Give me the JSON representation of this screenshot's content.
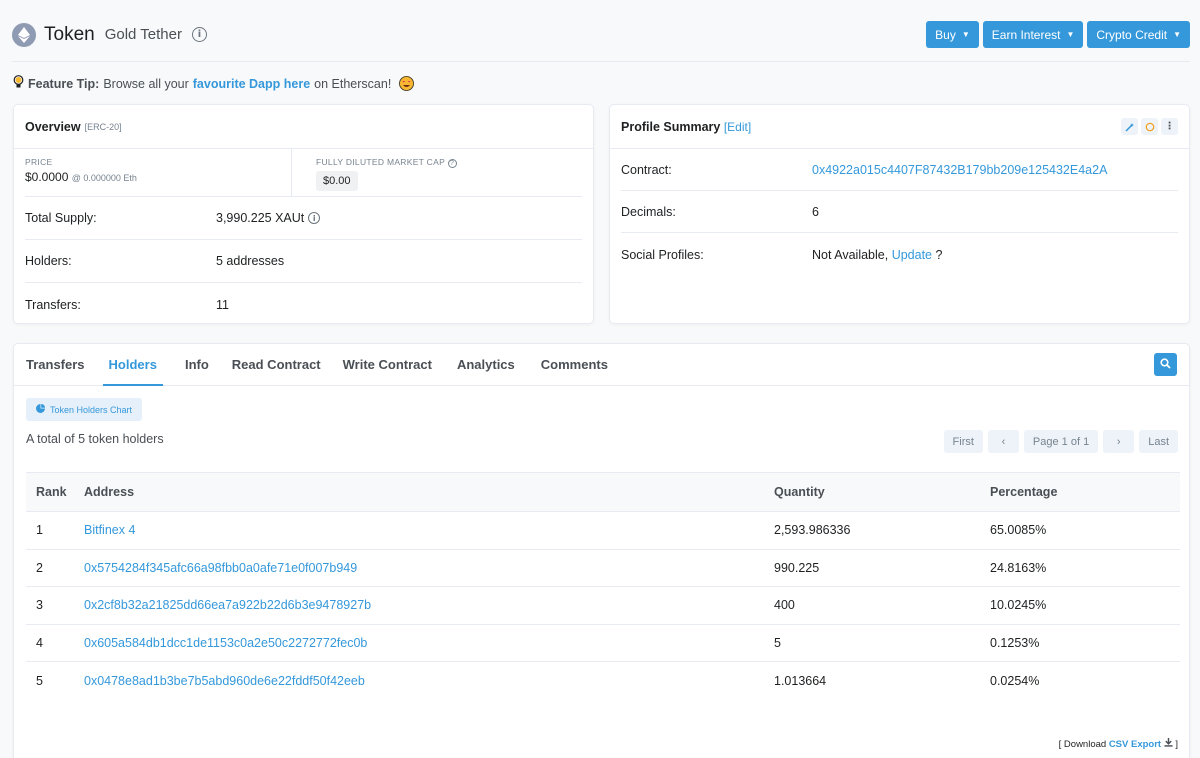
{
  "header": {
    "title": "Token",
    "subtitle": "Gold Tether",
    "buttons": [
      {
        "label": "Buy"
      },
      {
        "label": "Earn Interest"
      },
      {
        "label": "Crypto Credit"
      }
    ]
  },
  "feature_tip": {
    "label": "Feature Tip:",
    "text_before": "Browse all your",
    "link": "favourite Dapp here",
    "text_after": "on Etherscan!"
  },
  "overview": {
    "title": "Overview",
    "standard": "[ERC-20]",
    "price_label": "PRICE",
    "price_value": "$0.0000",
    "price_eth": "@ 0.000000 Eth",
    "mcap_label": "FULLY DILUTED MARKET CAP",
    "mcap_value": "$0.00",
    "rows": [
      {
        "key": "Total Supply:",
        "value": "3,990.225 XAUt"
      },
      {
        "key": "Holders:",
        "value": "5 addresses"
      },
      {
        "key": "Transfers:",
        "value": "11"
      }
    ]
  },
  "profile": {
    "title": "Profile Summary",
    "edit": "[Edit]",
    "contract_label": "Contract:",
    "contract_value": "0x4922a015c4407F87432B179bb209e125432E4a2A",
    "decimals_label": "Decimals:",
    "decimals_value": "6",
    "social_label": "Social Profiles:",
    "social_value": "Not Available,",
    "social_link": "Update",
    "social_q": "?"
  },
  "tabs": [
    {
      "label": "Transfers",
      "active": false
    },
    {
      "label": "Holders",
      "active": true
    },
    {
      "label": "Info",
      "active": false
    },
    {
      "label": "Read Contract",
      "active": false
    },
    {
      "label": "Write Contract",
      "active": false
    },
    {
      "label": "Analytics",
      "active": false
    },
    {
      "label": "Comments",
      "active": false
    }
  ],
  "holders": {
    "chart_button": "Token Holders Chart",
    "total_text": "A total of 5 token holders",
    "pager": {
      "first": "First",
      "prev": "‹",
      "page": "Page 1 of 1",
      "next": "›",
      "last": "Last"
    },
    "columns": [
      "Rank",
      "Address",
      "Quantity",
      "Percentage"
    ],
    "rows": [
      {
        "rank": "1",
        "address": "Bitfinex 4",
        "quantity": "2,593.986336",
        "percentage": "65.0085%"
      },
      {
        "rank": "2",
        "address": "0x5754284f345afc66a98fbb0a0afe71e0f007b949",
        "quantity": "990.225",
        "percentage": "24.8163%"
      },
      {
        "rank": "3",
        "address": "0x2cf8b32a21825dd66ea7a922b22d6b3e9478927b",
        "quantity": "400",
        "percentage": "10.0245%"
      },
      {
        "rank": "4",
        "address": "0x605a584db1dcc1de1153c0a2e50c2272772fec0b",
        "quantity": "5",
        "percentage": "0.1253%"
      },
      {
        "rank": "5",
        "address": "0x0478e8ad1b3be7b5abd960de6e22fddf50f42eeb",
        "quantity": "1.013664",
        "percentage": "0.0254%"
      }
    ],
    "csv_prefix": "[ Download",
    "csv_link": "CSV Export",
    "csv_suffix": "]"
  },
  "colors": {
    "accent": "#3498db",
    "border": "#e7eaf3",
    "text": "#1e2022"
  }
}
